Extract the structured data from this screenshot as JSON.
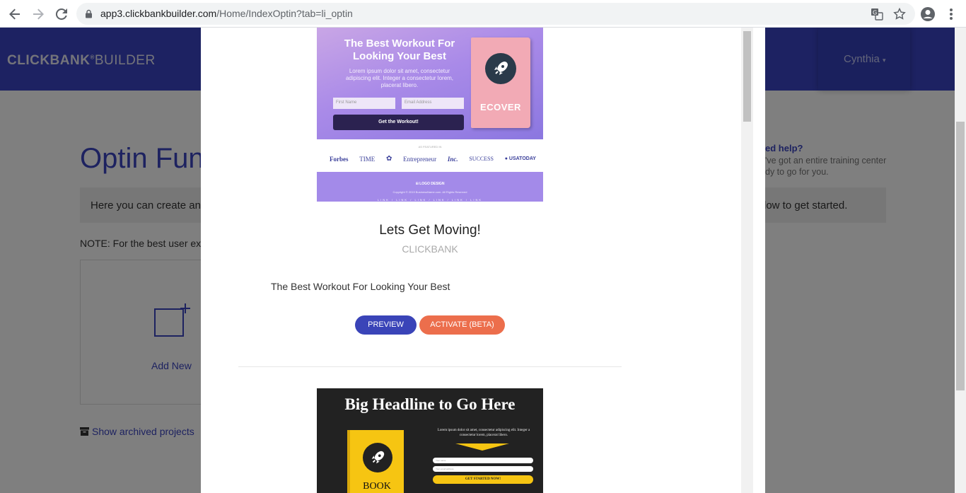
{
  "browser": {
    "url_host": "app3.clickbankbuilder.com",
    "url_path": "/Home/IndexOptin?tab=li_optin"
  },
  "page": {
    "brand_bold": "CLICKBANK",
    "brand_reg": "®",
    "brand_thin": "BUILDER",
    "user_name": "Cynthia",
    "title": "Optin Fun",
    "intro": "Here you can create an o",
    "intro_tail": "low to get started.",
    "note": "NOTE: For the best user ex",
    "help_title": "ed help?",
    "help_body": "'ve got an entire training center dy to go for you.",
    "add_new": "Add New",
    "archived": "Show archived projects"
  },
  "modal": {
    "item1": {
      "thumb": {
        "headline": "The Best Workout For Looking Your Best",
        "sub": "Lorem ipsum dolor sit amet, consectetur adipiscing elit. Integer a consectetur lorem, placerat libero.",
        "first_name": "First Name",
        "email": "Email Address",
        "button": "Get the Workout!",
        "book": "ECOVER",
        "featured": "AS FEATURED IN",
        "logos": [
          "Forbes",
          "TIME",
          "NBC",
          "Entrepreneur",
          "Inc.",
          "SUCCESS",
          "USATODAY"
        ],
        "footer_logo": "LOGO DESIGN",
        "copyright": "Copyright © 2019 BusinessName.com. All Rights Reserved",
        "links": "LINK / LINK / LINK / LINK / LINK / LINK"
      },
      "title": "Lets Get Moving!",
      "vendor": "CLICKBANK",
      "description": "The Best Workout For Looking Your Best",
      "preview_label": "PREVIEW",
      "activate_label": "ACTIVATE (BETA)"
    },
    "item2": {
      "thumb": {
        "headline": "Big Headline to Go Here",
        "text": "Lorem ipsum dolor sit amet, consectetur adipiscing elit. Integer a consectetur lorem, placerat libero.",
        "input1": "Your name",
        "input2": "Your email address",
        "button": "GET STARTED NOW!",
        "book": "BOOK"
      }
    }
  }
}
